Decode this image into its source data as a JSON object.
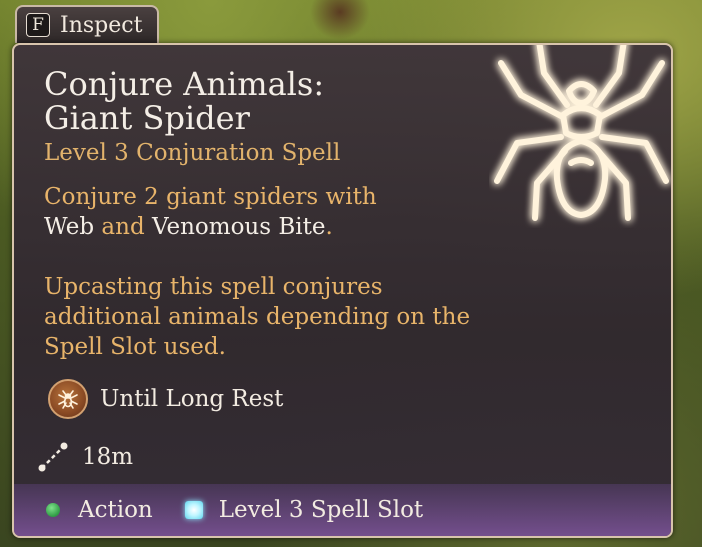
{
  "inspect": {
    "key": "F",
    "label": "Inspect"
  },
  "spell": {
    "title_line1": "Conjure Animals:",
    "title_line2": "Giant Spider",
    "subtitle": "Level 3 Conjuration Spell",
    "desc_line1": "Conjure 2 giant spiders with",
    "desc_hl_1": "Web",
    "desc_and": " and ",
    "desc_hl_2": "Venomous Bite",
    "desc_period": ".",
    "upcast": "Upcasting this spell conjures additional animals depending on the Spell Slot used.",
    "duration": "Until Long Rest",
    "range": "18m"
  },
  "footer": {
    "action": "Action",
    "slot": "Level 3 Spell Slot"
  },
  "icons": {
    "spell_art": "spider-icon",
    "duration": "spider-badge-icon",
    "range": "range-line-icon",
    "action": "green-dot-icon",
    "slot": "spell-slot-icon"
  },
  "colors": {
    "title": "#f4eee6",
    "subtitle": "#e2b36c",
    "text": "#e8b46a",
    "glow": "#ffcf7a",
    "footer": "#7a5296"
  }
}
